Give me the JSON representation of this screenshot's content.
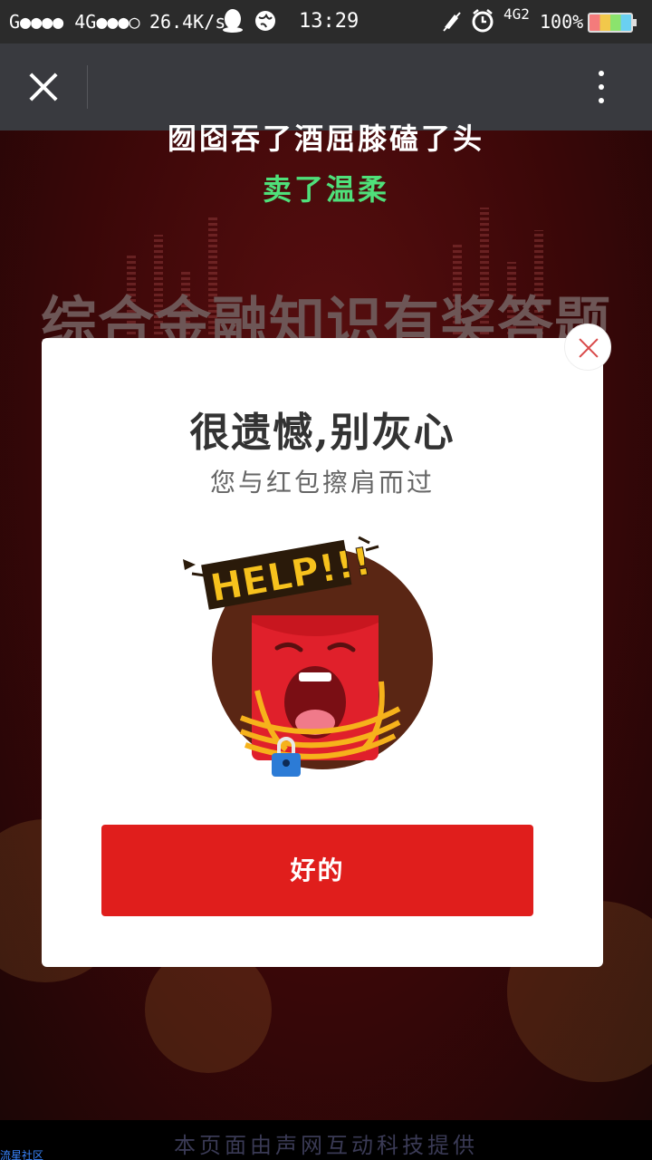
{
  "status_bar": {
    "signal": "G●●●● 4G●●●○",
    "speed": "26.4K/s",
    "time": "13:29",
    "network": "4G2",
    "battery": "100%",
    "icons": [
      "qq-icon",
      "globe-icon",
      "mute-icon",
      "alarm-icon",
      "battery-icon"
    ]
  },
  "toolbar": {
    "close_icon": "close-icon",
    "more_icon": "more-vertical-icon"
  },
  "background": {
    "title": "综合金融知识有奖答题",
    "lyric_line1": "囫囵吞了酒屈膝磕了头",
    "lyric_line2": "卖了温柔"
  },
  "modal": {
    "title": "很遗憾,别灰心",
    "subtitle": "您与红包擦肩而过",
    "illustration_text": "HELP!!!",
    "ok_button": "好的"
  },
  "footer": {
    "text": "本页面由声网互动科技提供",
    "watermark": "流星社区"
  },
  "colors": {
    "accent_red": "#e01e1c",
    "lyric_green": "#4fe07a",
    "toolbar": "#393a3f"
  }
}
